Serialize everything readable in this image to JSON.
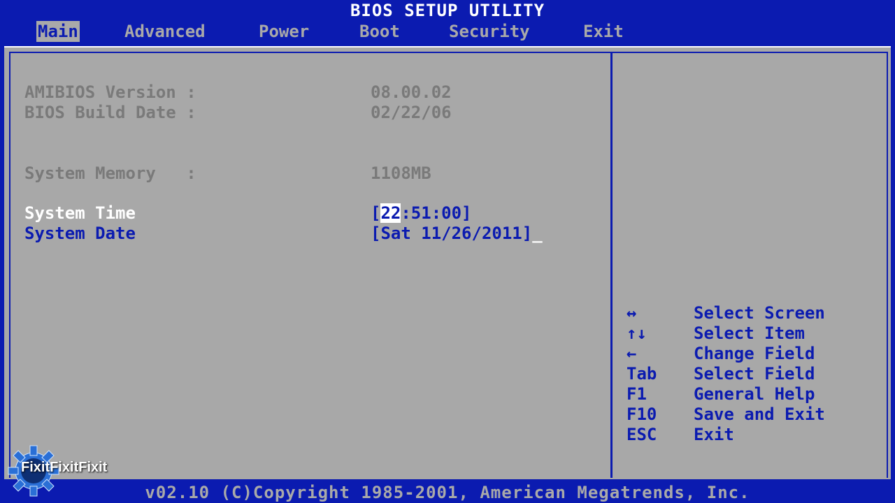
{
  "title": "BIOS SETUP UTILITY",
  "menu": [
    {
      "label": "Main",
      "active": true
    },
    {
      "label": "Advanced",
      "active": false
    },
    {
      "label": "Power",
      "active": false
    },
    {
      "label": "Boot",
      "active": false
    },
    {
      "label": "Security",
      "active": false
    },
    {
      "label": "Exit",
      "active": false
    }
  ],
  "info": {
    "amibios_label": "AMIBIOS Version :",
    "amibios_value": "08.00.02",
    "build_label": "BIOS Build Date :",
    "build_value": "02/22/06",
    "memory_label": "System Memory   :",
    "memory_value": "1108MB"
  },
  "settings": {
    "time_label": "System Time",
    "time_open": "[",
    "time_cursor": "22",
    "time_rest": ":51:00]",
    "date_label": "System Date",
    "date_value": "[Sat 11/26/2011]",
    "date_caret": "_"
  },
  "help": [
    {
      "key": "↔",
      "desc": "Select Screen"
    },
    {
      "key": "↑↓",
      "desc": "Select Item"
    },
    {
      "key": "←",
      "desc": "Change Field"
    },
    {
      "key": "Tab",
      "desc": "Select Field"
    },
    {
      "key": "F1",
      "desc": "General Help"
    },
    {
      "key": "F10",
      "desc": "Save and Exit"
    },
    {
      "key": "ESC",
      "desc": "Exit"
    }
  ],
  "footer": "v02.10 (C)Copyright 1985-2001, American Megatrends, Inc.",
  "watermark": "FixitFixitFixit",
  "colors": {
    "bios_blue": "#0b1bb0",
    "panel_gray": "#a8a8a8",
    "dim_text": "#7a7a7a",
    "highlight": "#ffffff"
  }
}
